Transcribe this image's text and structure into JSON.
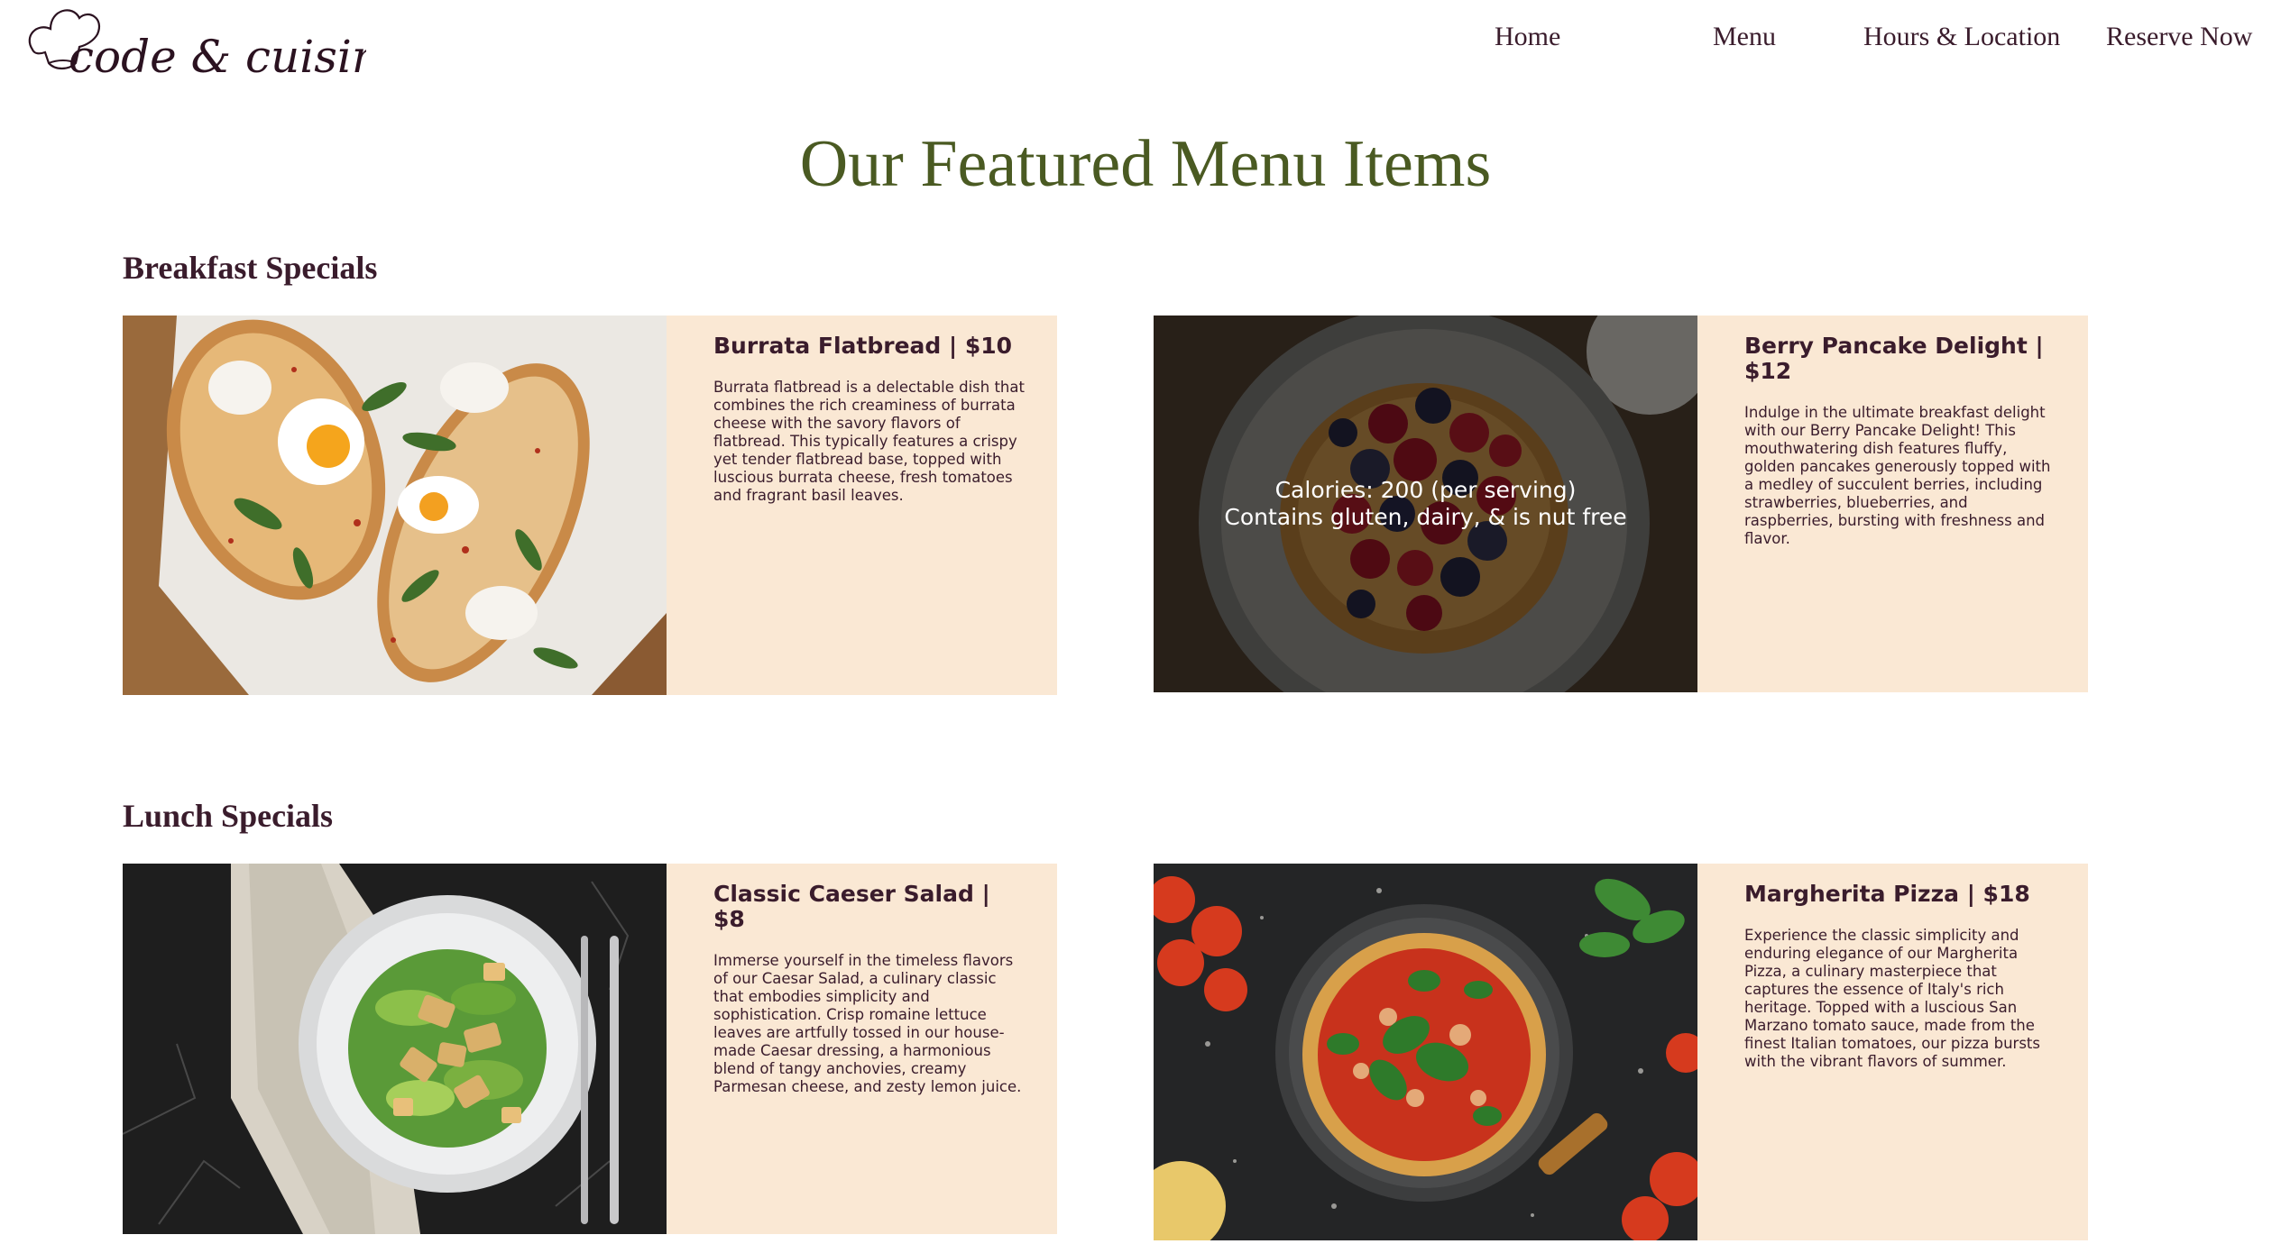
{
  "brand": {
    "logo_text": "code & cuisine"
  },
  "nav": {
    "home": "Home",
    "menu": "Menu",
    "hours": "Hours & Location",
    "reserve": "Reserve Now"
  },
  "page": {
    "title": "Our Featured Menu Items"
  },
  "sections": [
    {
      "title": "Breakfast Specials",
      "items": [
        {
          "title": "Burrata Flatbread | $10",
          "description": "Burrata flatbread is a delectable dish that combines the rich creaminess of burrata cheese with the savory flavors of flatbread. This typically features a crispy yet tender flatbread base, topped with luscious burrata cheese, fresh tomatoes and fragrant basil leaves.",
          "image": "burrata-flatbread-photo"
        },
        {
          "title": "Berry Pancake Delight | $12",
          "description": "Indulge in the ultimate breakfast delight with our Berry Pancake Delight! This mouthwatering dish features fluffy, golden pancakes generously topped with a medley of succulent berries, including strawberries, blueberries, and raspberries, bursting with freshness and flavor.",
          "image": "berry-pancake-photo",
          "overlay": {
            "calories": "Calories: 200 (per serving)",
            "allergens": "Contains gluten, dairy, & is nut free"
          }
        }
      ]
    },
    {
      "title": "Lunch Specials",
      "items": [
        {
          "title": "Classic Caeser Salad | $8",
          "description": "Immerse yourself in the timeless flavors of our Caesar Salad, a culinary classic that embodies simplicity and sophistication. Crisp romaine lettuce leaves are artfully tossed in our house-made Caesar dressing, a harmonious blend of tangy anchovies, creamy Parmesan cheese, and zesty lemon juice.",
          "image": "caesar-salad-photo"
        },
        {
          "title": "Margherita Pizza | $18",
          "description": "Experience the classic simplicity and enduring elegance of our Margherita Pizza, a culinary masterpiece that captures the essence of Italy's rich heritage. Topped with a luscious San Marzano tomato sauce, made from the finest Italian tomatoes, our pizza bursts with the vibrant flavors of summer.",
          "image": "margherita-pizza-photo"
        }
      ]
    }
  ],
  "colors": {
    "accent_title": "#4a5a22",
    "text_dark": "#3a1c2c",
    "card_bg": "#fae8d4"
  }
}
